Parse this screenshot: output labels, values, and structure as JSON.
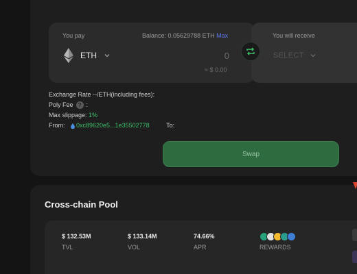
{
  "swap": {
    "you_pay_label": "You pay",
    "balance_text": "Balance: 0.05629788 ETH",
    "max_label": "Max",
    "pay_token": "ETH",
    "amount_placeholder": "0",
    "usd_value": "≈ $ 0.00",
    "receive_label": "You will receive",
    "receive_token_placeholder": "SELECT",
    "exchange_rate": "Exchange Rate --/ETH(including fees):",
    "poly_fee_label": "Poly Fee",
    "poly_fee_suffix": ":",
    "max_slippage_label": "Max slippage:",
    "max_slippage_value": "1%",
    "from_label": "From:",
    "from_address": "0xc89620e5...1e35502778",
    "to_label": "To:",
    "swap_button": "Swap"
  },
  "pool": {
    "title": "Cross-chain Pool",
    "stats": [
      {
        "value": "$ 132.53M",
        "label": "TVL"
      },
      {
        "value": "$ 133.14M",
        "label": "VOL"
      },
      {
        "value": "74.66%",
        "label": "APR"
      }
    ],
    "rewards_label": "REWARDS"
  },
  "colors": {
    "accent_green": "#3fbf6d",
    "swap_button_bg": "#2e6b3e",
    "max_link": "#5b78e8"
  },
  "icons": [
    "ethereum-icon",
    "chevron-down-icon",
    "swap-arrows-icon",
    "help-icon",
    "drop-icon",
    "reward-token-icons"
  ]
}
